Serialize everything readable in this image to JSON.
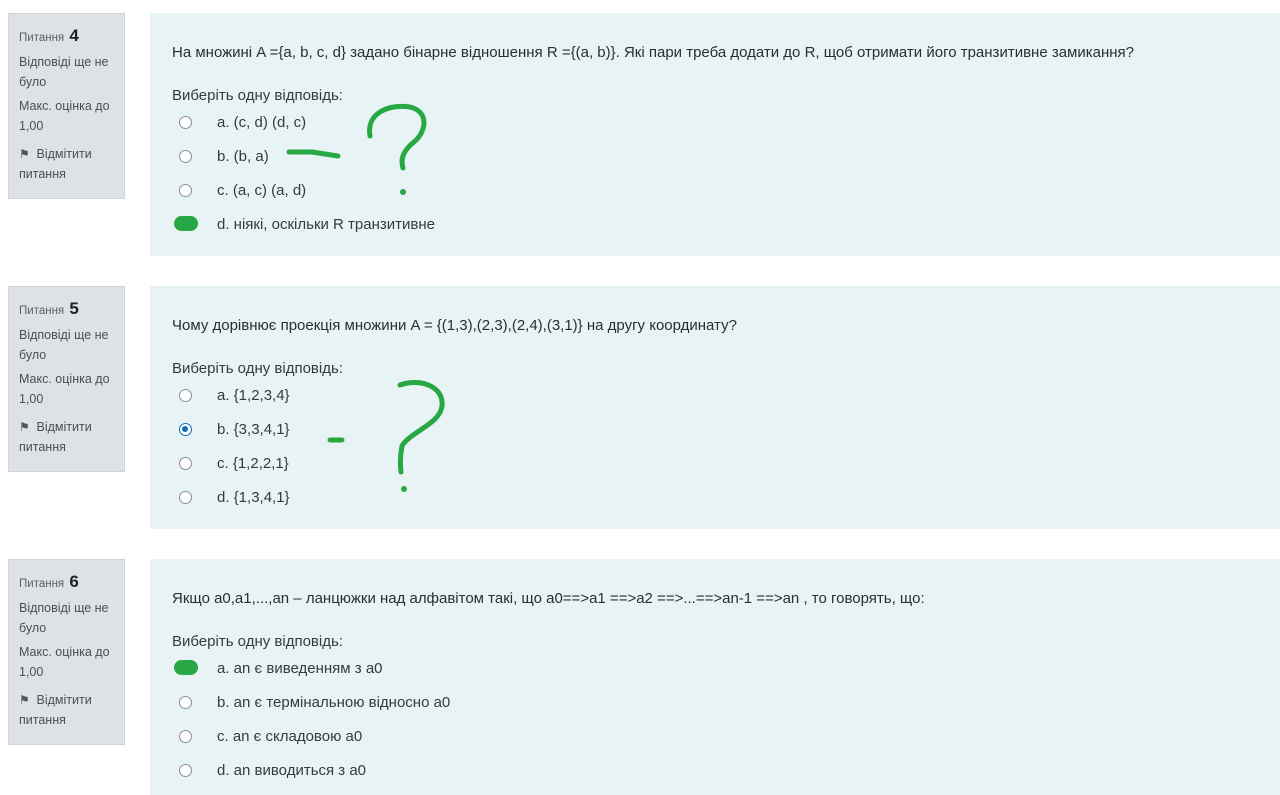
{
  "colors": {
    "annotation": "#27a844",
    "panel": "#e7f3f5",
    "info_panel": "#dee2e6",
    "radio_selected": "#0f6cbf"
  },
  "questions": [
    {
      "label": "Питання",
      "number": "4",
      "status": "Відповіді ще не було",
      "max_grade": "Макс. оцінка до 1,00",
      "flag_label": "Відмітити питання",
      "text": "На множині A ={a, b, c, d} задано бінарне відношення R ={(a, b)}. Які пари треба додати до R, щоб отримати його транзитивне замикання?",
      "prompt": "Виберіть одну відповідь:",
      "options": [
        {
          "label": "a. (c, d) (d, c)",
          "selected": false,
          "annotated": false
        },
        {
          "label": "b. (b, a)",
          "selected": false,
          "annotated": false
        },
        {
          "label": "c. (a, c) (a, d)",
          "selected": false,
          "annotated": false
        },
        {
          "label": "d. ніякі, оскільки R транзитивне",
          "selected": false,
          "annotated": true
        }
      ]
    },
    {
      "label": "Питання",
      "number": "5",
      "status": "Відповіді ще не було",
      "max_grade": "Макс. оцінка до 1,00",
      "flag_label": "Відмітити питання",
      "text": "Чому дорівнює проекція множини A = {(1,3),(2,3),(2,4),(3,1)} на другу координату?",
      "prompt": "Виберіть одну відповідь:",
      "options": [
        {
          "label": "a. {1,2,3,4}",
          "selected": false,
          "annotated": false
        },
        {
          "label": "b. {3,3,4,1}",
          "selected": true,
          "annotated": false
        },
        {
          "label": "c. {1,2,2,1}",
          "selected": false,
          "annotated": false
        },
        {
          "label": "d. {1,3,4,1}",
          "selected": false,
          "annotated": false
        }
      ]
    },
    {
      "label": "Питання",
      "number": "6",
      "status": "Відповіді ще не було",
      "max_grade": "Макс. оцінка до 1,00",
      "flag_label": "Відмітити питання",
      "text": "Якщо a0,a1,...,an – ланцюжки над алфавітом такі, що a0==>a1 ==>a2 ==>...==>an-1 ==>an , то говорять, що:",
      "prompt": "Виберіть одну відповідь:",
      "options": [
        {
          "label": "a. an є виведенням з a0",
          "selected": false,
          "annotated": true
        },
        {
          "label": "b. an є термінальною відносно a0",
          "selected": false,
          "annotated": false
        },
        {
          "label": "c. an є складовою a0",
          "selected": false,
          "annotated": false
        },
        {
          "label": "d. an виводиться з a0",
          "selected": false,
          "annotated": false
        }
      ]
    }
  ]
}
